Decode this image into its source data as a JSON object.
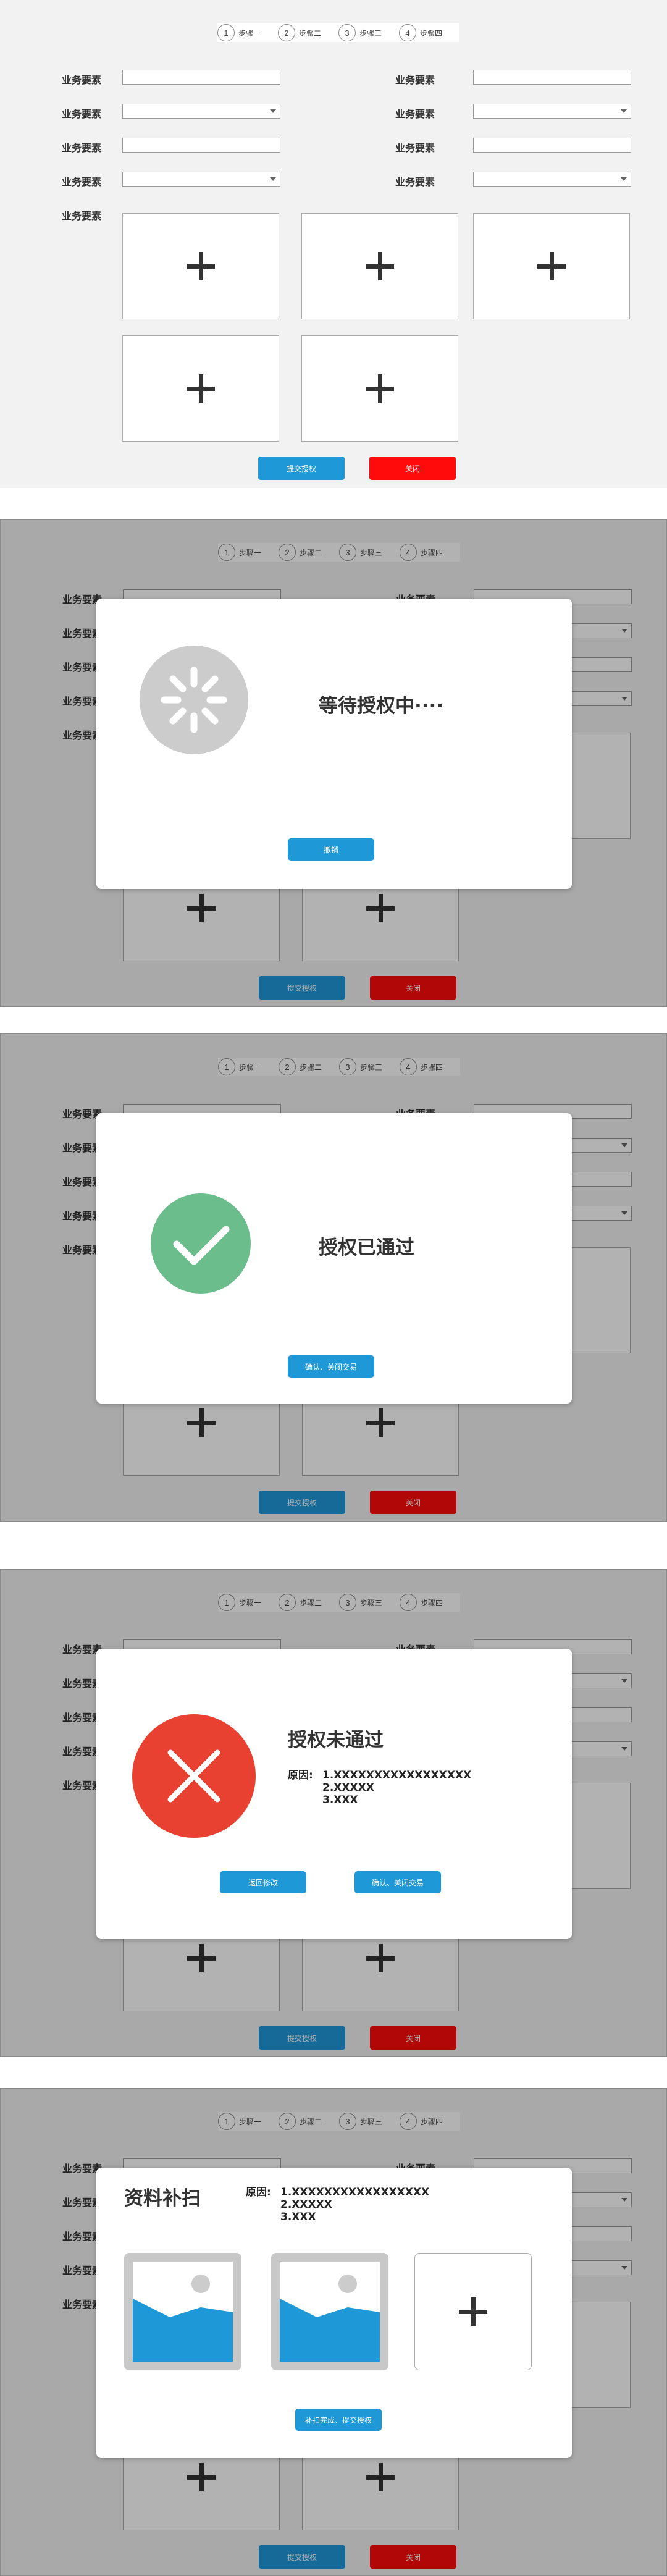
{
  "steps": [
    {
      "num": "1",
      "label": "步骤一"
    },
    {
      "num": "2",
      "label": "步骤二"
    },
    {
      "num": "3",
      "label": "步骤三"
    },
    {
      "num": "4",
      "label": "步骤四"
    }
  ],
  "form": {
    "field_label": "业务要素"
  },
  "actions": {
    "submit_label": "提交授权",
    "close_label": "关闭"
  },
  "waiting_modal": {
    "title": "等待授权中····",
    "cancel_label": "撤销"
  },
  "approved_modal": {
    "title": "授权已通过",
    "confirm_label": "确认、关闭交易"
  },
  "rejected_modal": {
    "title": "授权未通过",
    "reason_label": "原因:",
    "reasons": [
      "1.XXXXXXXXXXXXXXXXX",
      "2.XXXXX",
      "3.XXX"
    ],
    "back_label": "返回修改",
    "confirm_label": "确认、关闭交易"
  },
  "rescan_modal": {
    "title": "资料补扫",
    "reason_label": "原因:",
    "reasons": [
      "1.XXXXXXXXXXXXXXXXX",
      "2.XXXXX",
      "3.XXX"
    ],
    "submit_label": "补扫完成、提交授权"
  },
  "colors": {
    "primary": "#1f98d8",
    "danger": "#ff0b0b",
    "success": "#6bbd8b",
    "error": "#e84132",
    "spinner": "#cccccc"
  },
  "icons": [
    "plus-icon",
    "spinner-icon",
    "check-icon",
    "cross-icon",
    "image-icon",
    "dropdown-caret-icon"
  ]
}
